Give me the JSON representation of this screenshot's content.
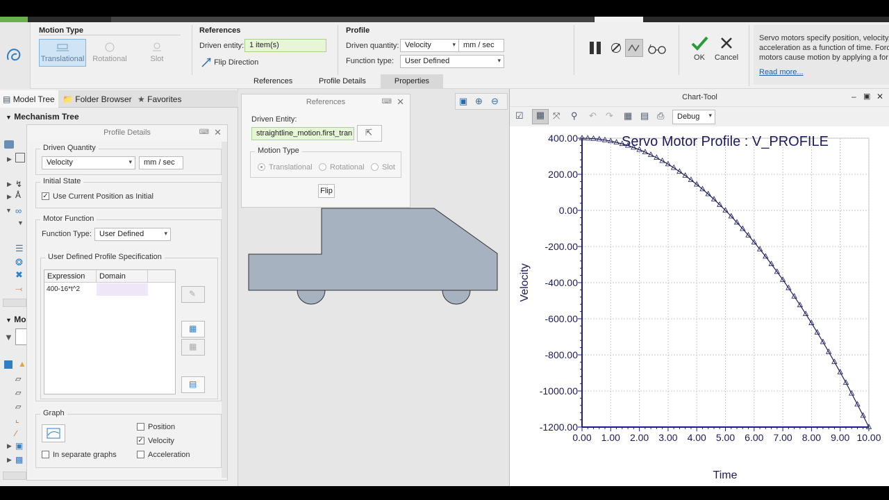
{
  "ribbon": {
    "motion_type": {
      "title": "Motion Type",
      "options": [
        "Translational",
        "Rotational",
        "Slot"
      ],
      "selected": "Translational"
    },
    "references": {
      "title": "References",
      "driven_entity_label": "Driven entity:",
      "driven_entity_value": "1 item(s)",
      "flip_label": "Flip Direction"
    },
    "profile": {
      "title": "Profile",
      "driven_quantity_label": "Driven quantity:",
      "driven_quantity_value": "Velocity",
      "units": "mm / sec",
      "function_type_label": "Function type:",
      "function_type_value": "User Defined"
    },
    "actions": {
      "ok": "OK",
      "cancel": "Cancel"
    },
    "help": {
      "line1": "Servo motors specify position, velocity,",
      "line2": "acceleration as a function of time. Forc",
      "line3": "motors cause motion by applying a for",
      "link": "Read more..."
    },
    "tabs": [
      "References",
      "Profile Details",
      "Properties"
    ],
    "active_tab": "Properties"
  },
  "sidebar": {
    "tabs": [
      "Model Tree",
      "Folder Browser",
      "Favorites"
    ],
    "tree_title": "Mechanism Tree",
    "section2_prefix": "Mo"
  },
  "profile_details": {
    "title": "Profile Details",
    "driven_quantity": {
      "label": "Driven Quantity",
      "value": "Velocity",
      "units": "mm / sec"
    },
    "initial_state": {
      "label": "Initial State",
      "checkbox_label": "Use Current Position as Initial",
      "checked": true
    },
    "motor_function": {
      "label": "Motor Function",
      "function_type_label": "Function Type:",
      "function_type_value": "User Defined",
      "spec_label": "User Defined Profile Specification",
      "table_headers": [
        "Expression",
        "Domain"
      ],
      "rows": [
        {
          "expression": "400-16*t^2",
          "domain": ""
        }
      ]
    },
    "graph": {
      "label": "Graph",
      "position": "Position",
      "velocity": "Velocity",
      "acceleration": "Acceleration",
      "separate": "In separate graphs",
      "checked": {
        "position": false,
        "velocity": true,
        "acceleration": false,
        "separate": false
      }
    }
  },
  "references_panel": {
    "title": "References",
    "driven_entity_label": "Driven Entity:",
    "driven_entity_value": "straightline_motion.first_tran",
    "motion_type_label": "Motion Type",
    "options": [
      "Translational",
      "Rotational",
      "Slot"
    ],
    "flip": "Flip"
  },
  "chart_tool": {
    "window_title": "Chart-Tool",
    "debug_label": "Debug"
  },
  "chart_data": {
    "type": "line",
    "title": "Servo Motor Profile : V_PROFILE",
    "xlabel": "Time",
    "ylabel": "Velocity",
    "xlim": [
      0,
      10
    ],
    "ylim": [
      -1200,
      400
    ],
    "x_ticks": [
      "0.00",
      "1.00",
      "2.00",
      "3.00",
      "4.00",
      "5.00",
      "6.00",
      "7.00",
      "8.00",
      "9.00",
      "10.00"
    ],
    "y_ticks": [
      "400.00",
      "200.00",
      "0.00",
      "-200.00",
      "-400.00",
      "-600.00",
      "-800.00",
      "-1000.00",
      "-1200.00"
    ],
    "grid": true,
    "marker": "triangle",
    "series": [
      {
        "x": [
          0,
          0.2,
          0.4,
          0.6,
          0.8,
          1,
          1.2,
          1.4,
          1.6,
          1.8,
          2,
          2.2,
          2.4,
          2.6,
          2.8,
          3,
          3.2,
          3.4,
          3.6,
          3.8,
          4,
          4.2,
          4.4,
          4.6,
          4.8,
          5,
          5.2,
          5.4,
          5.6,
          5.8,
          6,
          6.2,
          6.4,
          6.6,
          6.8,
          7,
          7.2,
          7.4,
          7.6,
          7.8,
          8,
          8.2,
          8.4,
          8.6,
          8.8,
          9,
          9.2,
          9.4,
          9.6,
          9.8,
          10
        ],
        "values": [
          400,
          399.36,
          397.44,
          394.24,
          389.76,
          384,
          376.96,
          368.64,
          359.04,
          348.16,
          336,
          322.56,
          307.84,
          291.84,
          274.56,
          256,
          236.16,
          215.04,
          192.64,
          168.96,
          144,
          117.76,
          90.24,
          61.44,
          31.36,
          0,
          -32.64,
          -66.56,
          -101.76,
          -138.24,
          -176,
          -215.04,
          -255.36,
          -296.96,
          -339.84,
          -384,
          -429.44,
          -476.16,
          -524.16,
          -573.44,
          -624,
          -675.84,
          -728.96,
          -783.36,
          -839.04,
          -896,
          -954.24,
          -1013.76,
          -1074.56,
          -1136.64,
          -1200
        ]
      }
    ],
    "line_color": "#1b1b5e"
  }
}
